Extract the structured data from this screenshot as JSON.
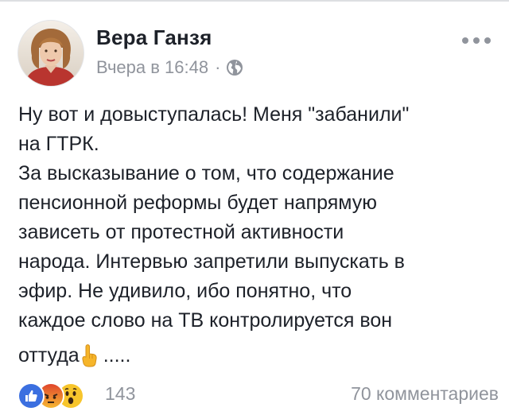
{
  "post": {
    "author": "Вера Ганзя",
    "timestamp": "Вчера в 16:48",
    "separator": "·",
    "privacy_icon": "globe-icon",
    "more_icon": "more-horizontal-icon",
    "text_lines": [
      "Ну вот и довыступалась! Меня \"забанили\"",
      "на ГТРК.",
      "За высказывание о том, что содержание",
      "пенсионной реформы будет напрямую",
      "зависеть от протестной активности",
      "народа. Интервью запретили выпускать в",
      "эфир. Не удивило, ибо понятно, что",
      "каждое слово на ТВ контролируется вон"
    ],
    "last_line_start": "оттуда",
    "finger_icon": "pointing-up-emoji-icon",
    "last_line_end": ".....",
    "reactions": {
      "icons": [
        "like-reaction-icon",
        "angry-reaction-icon",
        "wow-reaction-icon"
      ],
      "count": "143"
    },
    "comments": "70 комментариев"
  },
  "colors": {
    "text": "#1d2129",
    "secondary": "#90949c",
    "like": "#3b6fe0",
    "angry": "#e9710f",
    "wow": "#f7c52c"
  }
}
